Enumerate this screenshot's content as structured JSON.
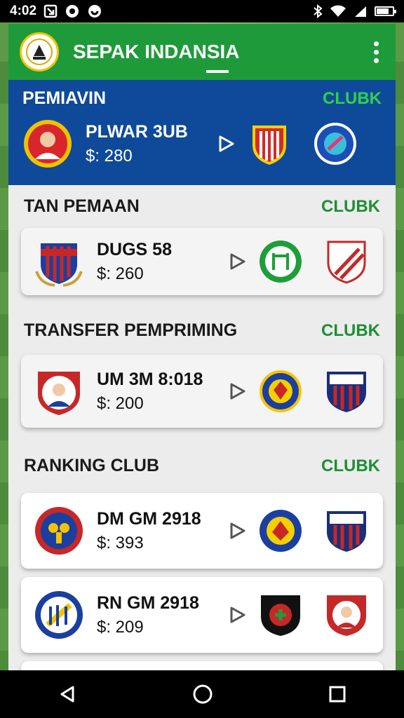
{
  "status": {
    "time": "4:02",
    "battery_icon": "battery-icon"
  },
  "app": {
    "title": "SEPAK INDANSIA",
    "brand_color": "#1f9a3a",
    "featured_color": "#0f4a9a"
  },
  "sections": [
    {
      "title": "PEMIAVIN",
      "link": "CLUBK",
      "items": [
        {
          "name": "PLWAR 3UB",
          "price": "$: 280"
        }
      ]
    },
    {
      "title": "TAN PEMAAN",
      "link": "CLUBK",
      "items": [
        {
          "name": "DUGS 58",
          "price": "$: 260"
        }
      ]
    },
    {
      "title": "TRANSFER PEMPRIMING",
      "link": "CLUBK",
      "items": [
        {
          "name": "UM 3M 8:018",
          "price": "$: 200"
        }
      ]
    },
    {
      "title": "RANKING CLUB",
      "link": "CLUBK",
      "items": [
        {
          "name": "DM GM 2918",
          "price": "$: 393"
        },
        {
          "name": "RN GM 2918",
          "price": "$: 209"
        }
      ]
    }
  ]
}
